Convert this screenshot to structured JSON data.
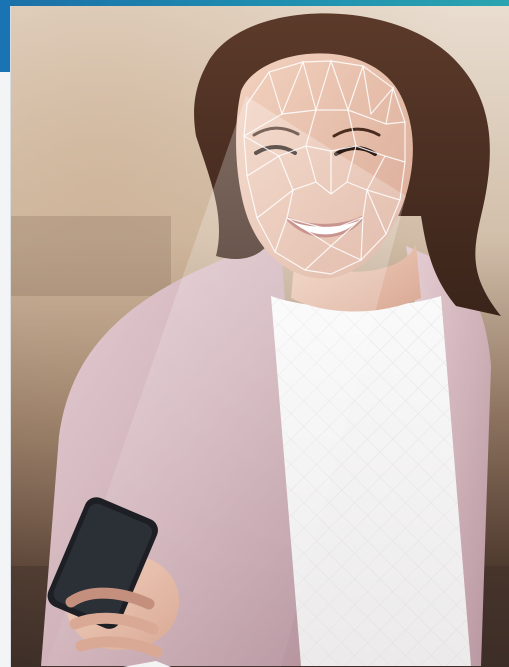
{
  "photo": {
    "subject": "photo-woman-facial-recognition",
    "accent_color": "#1a74b3"
  }
}
